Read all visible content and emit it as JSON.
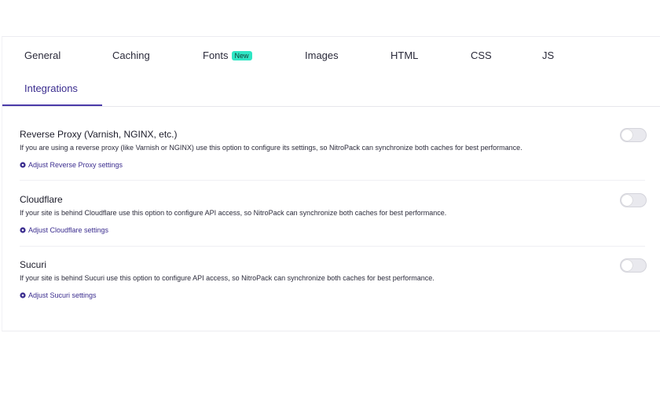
{
  "tabs": {
    "general": "General",
    "caching": "Caching",
    "fonts": "Fonts",
    "fonts_badge": "New",
    "images": "Images",
    "html": "HTML",
    "css": "CSS",
    "js": "JS",
    "integrations": "Integrations",
    "active": "Integrations"
  },
  "settings": [
    {
      "title": "Reverse Proxy (Varnish, NGINX, etc.)",
      "description": "If you are using a reverse proxy (like Varnish or NGINX) use this option to configure its settings, so NitroPack can synchronize both caches for best performance.",
      "link": "Adjust Reverse Proxy settings",
      "enabled": false
    },
    {
      "title": "Cloudflare",
      "description": "If your site is behind Cloudflare use this option to configure API access, so NitroPack can synchronize both caches for best performance.",
      "link": "Adjust Cloudflare settings",
      "enabled": false
    },
    {
      "title": "Sucuri",
      "description": "If your site is behind Sucuri use this option to configure API access, so NitroPack can synchronize both caches for best performance.",
      "link": "Adjust Sucuri settings",
      "enabled": false
    }
  ],
  "colors": {
    "accent": "#3b2d8f",
    "badge": "#2ee6c4",
    "toggle_off": "#e9e9ee"
  },
  "icons": {
    "link_icon": "gear-icon"
  }
}
